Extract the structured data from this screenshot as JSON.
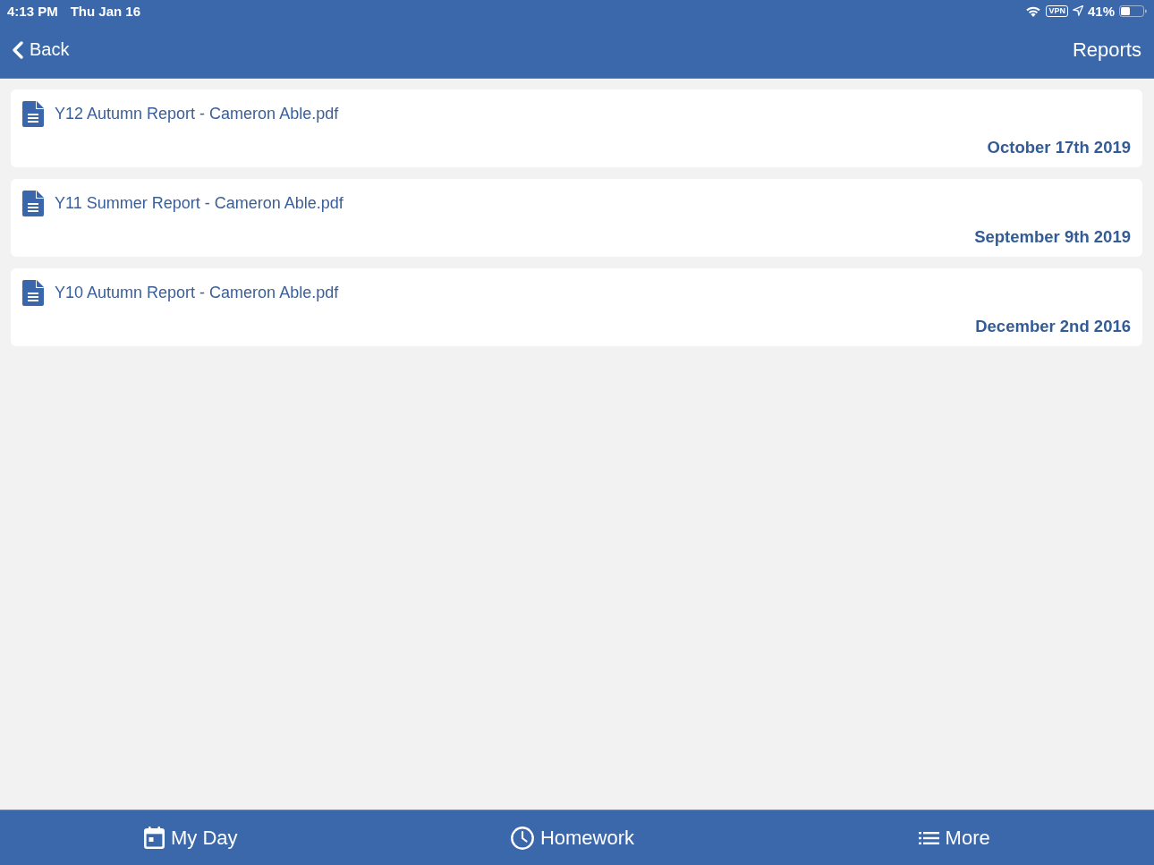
{
  "status_bar": {
    "time": "4:13 PM",
    "date": "Thu Jan 16",
    "vpn": "VPN",
    "battery": "41%"
  },
  "nav_bar": {
    "back": "Back",
    "title": "Reports"
  },
  "reports": [
    {
      "file": "Y12 Autumn Report - Cameron Able.pdf",
      "date": "October 17th 2019"
    },
    {
      "file": "Y11 Summer Report - Cameron Able.pdf",
      "date": "September 9th 2019"
    },
    {
      "file": "Y10 Autumn Report - Cameron Able.pdf",
      "date": "December 2nd 2016"
    }
  ],
  "tab_bar": {
    "tabs": [
      {
        "label": "My Day"
      },
      {
        "label": "Homework"
      },
      {
        "label": "More"
      }
    ]
  }
}
